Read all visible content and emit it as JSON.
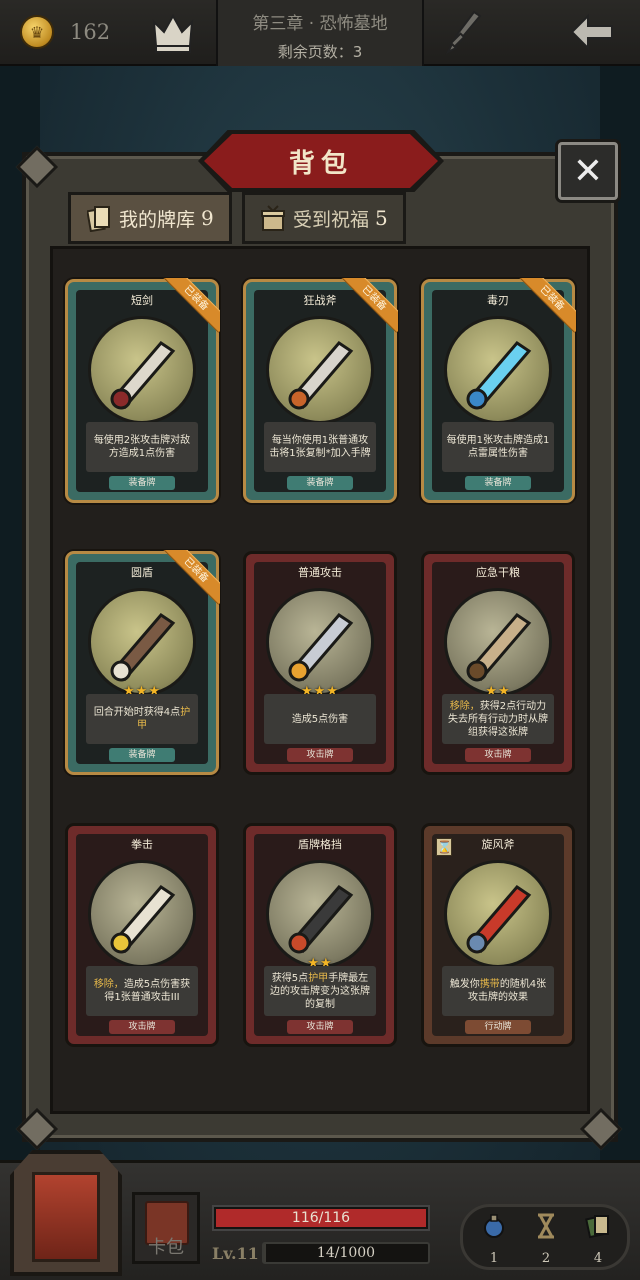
{
  "topbar": {
    "gold": "162",
    "chapter_title": "第三章 · 恐怖墓地",
    "pages_left": "剩余页数：3"
  },
  "panel": {
    "title": "背包",
    "tabs": [
      {
        "label": "我的牌库",
        "count": "9",
        "active": true
      },
      {
        "label": "受到祝福",
        "count": "5",
        "active": false
      }
    ]
  },
  "cards": [
    {
      "name": "短剑",
      "type": "装备牌",
      "text": "每使用2张攻击牌对敌方造成1点伤害",
      "equipped_label": "已装备",
      "stars": "",
      "kind": "equipment",
      "icon": "dagger-icon"
    },
    {
      "name": "狂战斧",
      "type": "装备牌",
      "text": "每当你使用1张普通攻击将1张复制*加入手牌",
      "equipped_label": "已装备",
      "stars": "",
      "kind": "equipment",
      "icon": "axe-icon"
    },
    {
      "name": "毒刃",
      "type": "装备牌",
      "text": "每使用1张攻击牌造成1点雷属性伤害",
      "equipped_label": "已装备",
      "stars": "",
      "kind": "equipment",
      "icon": "blade-icon"
    },
    {
      "name": "圆盾",
      "type": "装备牌",
      "text_prefix": "回合开始时获得4点",
      "text_highlight": "护甲",
      "text_suffix": "",
      "equipped_label": "已装备",
      "stars": "★★★",
      "kind": "equipment",
      "icon": "shield-icon"
    },
    {
      "name": "普通攻击",
      "type": "攻击牌",
      "text": "造成5点伤害",
      "equipped_label": "",
      "stars": "★★★",
      "kind": "attack",
      "icon": "sword-slash-icon"
    },
    {
      "name": "应急干粮",
      "type": "攻击牌",
      "text_prefix": "",
      "text_highlight": "移除，",
      "text_suffix": "获得2点行动力失去所有行动力时从牌组获得这张牌",
      "equipped_label": "",
      "stars": "★★",
      "kind": "attack",
      "icon": "ration-icon"
    },
    {
      "name": "拳击",
      "type": "攻击牌",
      "text_prefix": "",
      "text_highlight": "移除，",
      "text_suffix": "造成5点伤害获得1张普通攻击III",
      "equipped_label": "",
      "stars": "",
      "kind": "attack",
      "icon": "fist-icon"
    },
    {
      "name": "盾牌格挡",
      "type": "攻击牌",
      "text_prefix": "获得5点",
      "text_highlight": "护甲",
      "text_suffix": "手牌最左边的攻击牌变为这张牌的复制",
      "equipped_label": "",
      "stars": "★★",
      "kind": "attack",
      "icon": "shield-block-icon"
    },
    {
      "name": "旋风斧",
      "type": "行动牌",
      "text_prefix": "触发你",
      "text_highlight": "携带",
      "text_suffix": "的随机4张攻击牌的效果",
      "equipped_label": "",
      "stars": "",
      "kind": "action",
      "icon": "whirl-axe-icon"
    }
  ],
  "bottombar": {
    "deck_label": "卡包",
    "hp": "116/116",
    "hp_fraction": 1.0,
    "level": "Lv.11",
    "xp": "14/1000",
    "xp_fraction": 0.014,
    "inventory": [
      {
        "icon": "potion-icon",
        "count": "1"
      },
      {
        "icon": "hourglass-icon",
        "count": "2"
      },
      {
        "icon": "cards-icon",
        "count": "4"
      }
    ]
  },
  "colors": {
    "equipment": "#3b6b63",
    "attack": "#6e2b2a",
    "action": "#5c3a2a",
    "ribbon": "#d88a2a",
    "hp": "#b02a2a",
    "star": "#f3b526"
  }
}
